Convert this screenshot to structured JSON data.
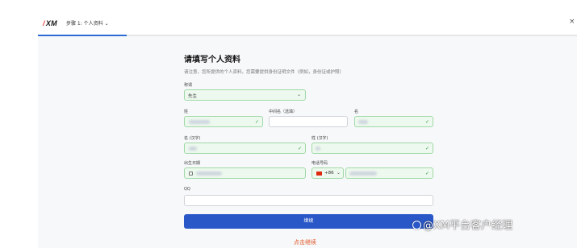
{
  "header": {
    "logo": "XM",
    "step_label": "步骤 1: 个人资料",
    "close_glyph": "×",
    "progress_fraction": 0.165
  },
  "form": {
    "title": "请填写个人资料",
    "notice": "请注意，您所提供的个人资料，您需要提供身份证明文件（例如，身份证或护照）",
    "salutation": {
      "label": "称谓",
      "value": "先生"
    },
    "last_name": {
      "label": "姓"
    },
    "middle_name": {
      "label": "中间名（选填）"
    },
    "first_name": {
      "label": "名"
    },
    "last_name_cn": {
      "label": "名 (汉字)"
    },
    "first_name_cn": {
      "label": "姓 (汉字)"
    },
    "dob": {
      "label": "出生日期"
    },
    "phone": {
      "label": "电话号码",
      "country_code": "+86"
    },
    "qq": {
      "label": "QQ"
    },
    "continue_label": "继续",
    "link_label": "点击继续"
  },
  "watermark": "@XM平台客户经理",
  "colors": {
    "accent": "#2957c8",
    "valid_border": "#9fd9a6",
    "check": "#2e9b45",
    "link": "#e05a2b",
    "logo_slash": "#e53935"
  }
}
